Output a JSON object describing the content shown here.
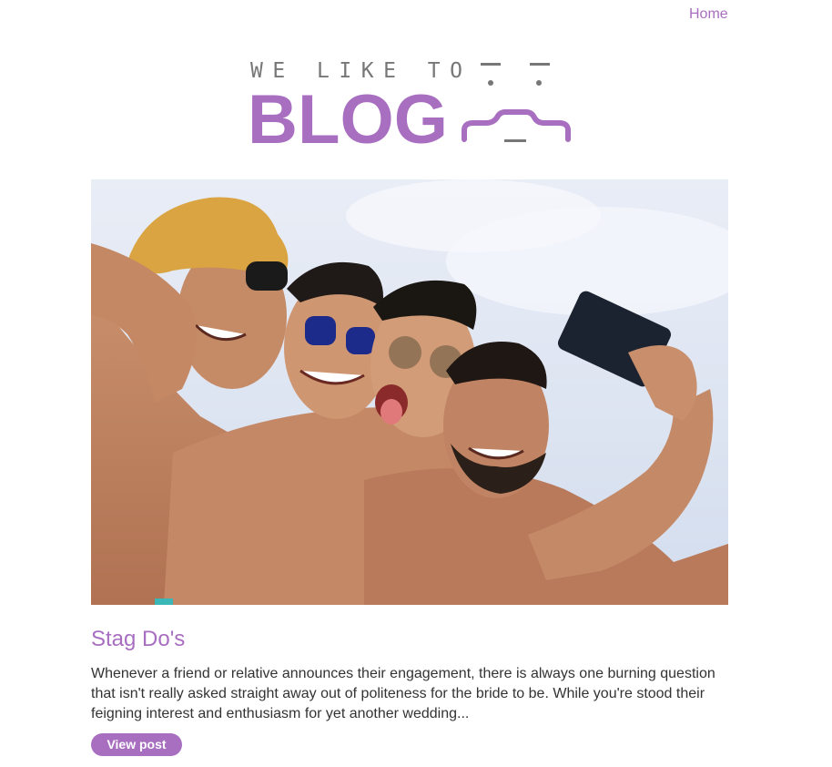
{
  "nav": {
    "home_label": "Home"
  },
  "logo": {
    "tagline": "WE LIKE TO",
    "wordmark": "BLOG",
    "face_icon": "brace-face-icon"
  },
  "hero": {
    "image_icon": "group-selfie-photo"
  },
  "post": {
    "title": "Stag Do's",
    "excerpt": "Whenever a friend or relative announces their engagement, there is always one burning question that isn't really asked straight away out of politeness for the bride to be. While you're stood their feigning interest and enthusiasm for yet another wedding...",
    "button_label": "View post"
  },
  "colors": {
    "accent": "#a86ec0",
    "text": "#333333",
    "logo_grey": "#777777"
  }
}
